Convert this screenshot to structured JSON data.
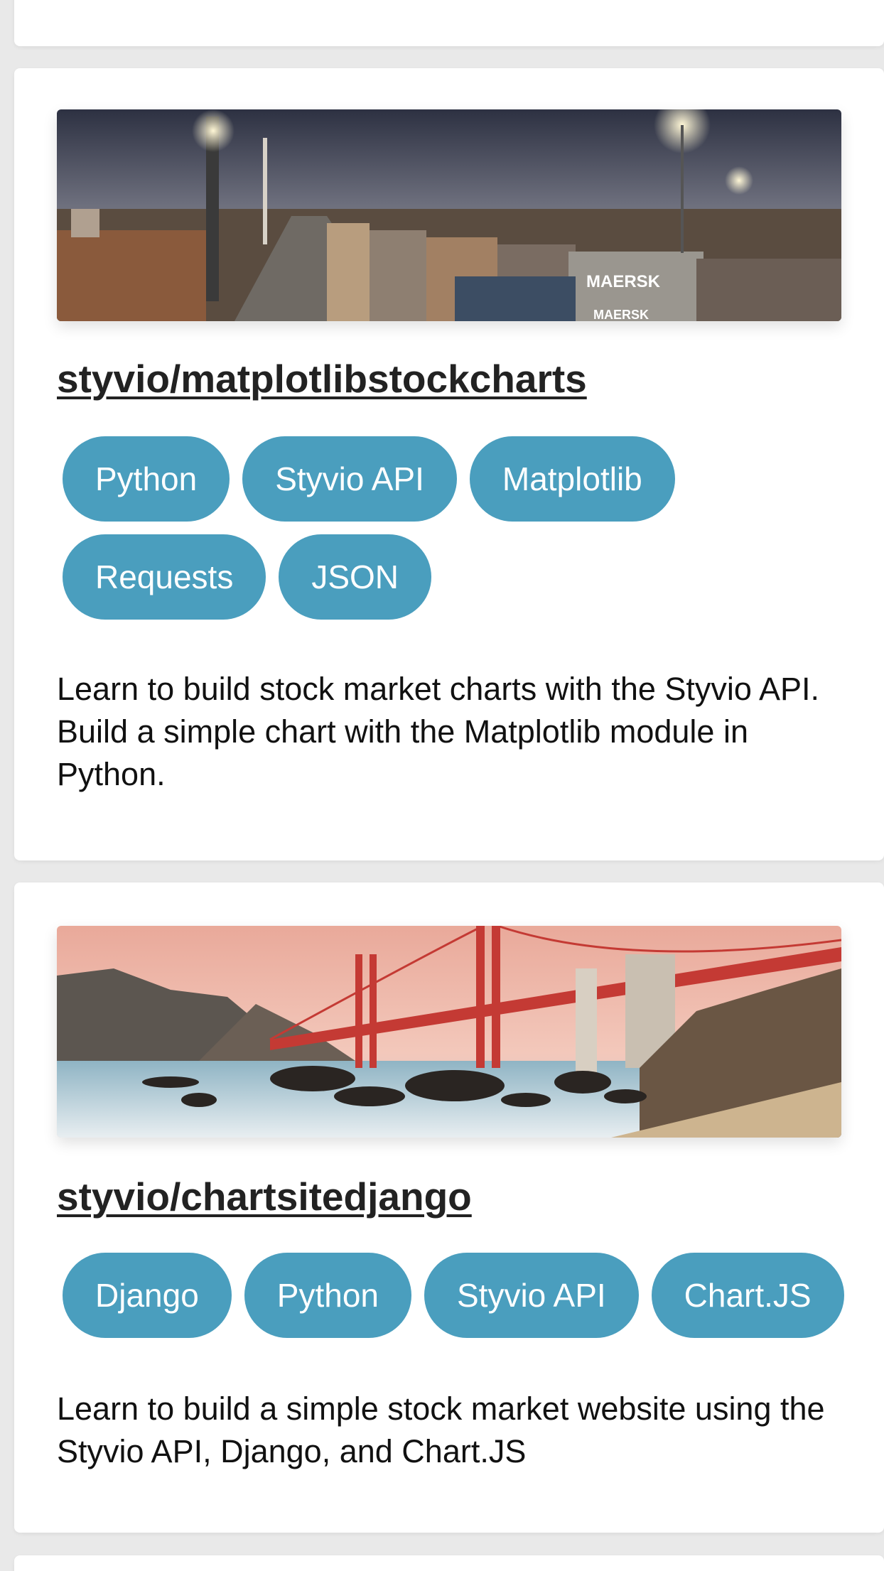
{
  "cards": [
    {
      "title": "styvio/matplotlibstockcharts",
      "image_alt": "shipping-port-image",
      "tags_row1": [
        "Python",
        "Styvio API",
        "Matplotlib"
      ],
      "tags_row2": [
        "Requests",
        "JSON"
      ],
      "description": "Learn to build stock market charts with the Styvio API. Build a simple chart with the Matplotlib module in Python."
    },
    {
      "title": "styvio/chartsitedjango",
      "image_alt": "golden-gate-bridge-image",
      "tags_row1": [
        "Django",
        "Python",
        "Styvio API",
        "Chart.JS"
      ],
      "description": "Learn to build a simple stock market website using the Styvio API, Django, and Chart.JS"
    }
  ],
  "image_text": {
    "container_brand_1": "MAERSK",
    "container_brand_2": "MAERSK"
  },
  "colors": {
    "tag_bg": "#4a9ebe",
    "tag_text": "#ffffff",
    "page_bg": "#e9e9e9",
    "card_bg": "#ffffff"
  }
}
